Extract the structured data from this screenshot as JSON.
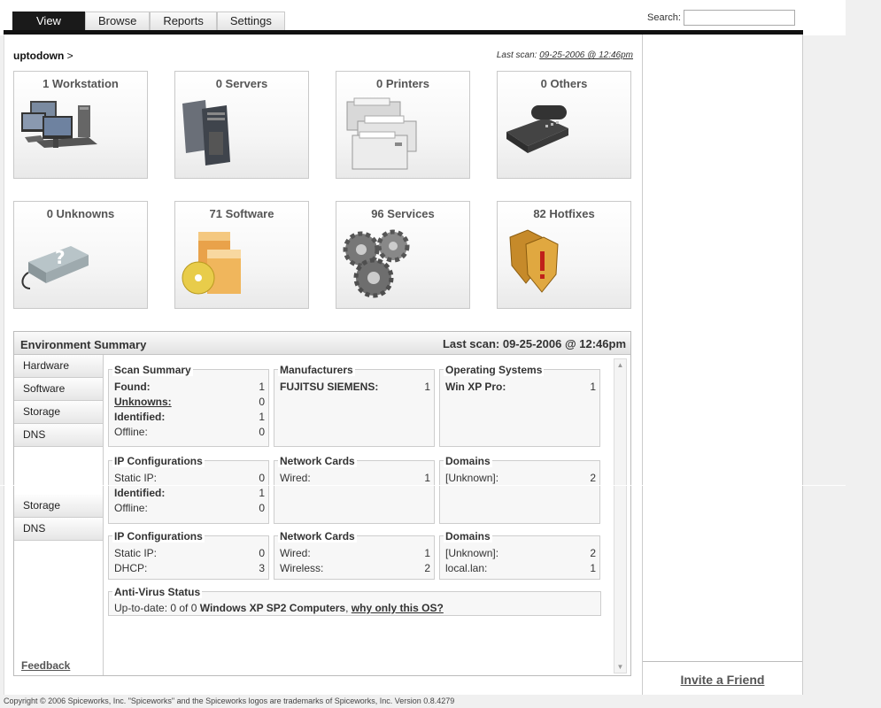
{
  "nav": {
    "tabs": [
      "View",
      "Browse",
      "Reports",
      "Settings"
    ],
    "search_label": "Search:",
    "search_value": ""
  },
  "breadcrumb": {
    "location": "uptodown",
    "separator": ">"
  },
  "last_scan_top": {
    "label": "Last scan:",
    "date": "09-25-2006 @ 12:46pm"
  },
  "cards": [
    {
      "label": "1 Workstation",
      "icon": "workstation-icon"
    },
    {
      "label": "0 Servers",
      "icon": "server-icon"
    },
    {
      "label": "0 Printers",
      "icon": "printer-icon"
    },
    {
      "label": "0 Others",
      "icon": "phone-icon"
    },
    {
      "label": "0 Unknowns",
      "icon": "unknown-device-icon"
    },
    {
      "label": "71 Software",
      "icon": "software-icon"
    },
    {
      "label": "96 Services",
      "icon": "gears-icon"
    },
    {
      "label": "82 Hotfixes",
      "icon": "shield-icon"
    }
  ],
  "env": {
    "title": "Environment Summary",
    "last_scan": "Last scan: 09-25-2006 @ 12:46pm",
    "nav": [
      "Hardware",
      "Software",
      "Storage",
      "DNS",
      "Storage",
      "DNS"
    ],
    "feedback": "Feedback",
    "scan_summary": {
      "title": "Scan Summary",
      "rows": [
        {
          "k": "Found:",
          "v": "1"
        },
        {
          "k": "Unknowns:",
          "v": "0"
        },
        {
          "k": "Identified:",
          "v": "1"
        },
        {
          "k": "Offline:",
          "v": "0"
        }
      ]
    },
    "manufacturers": {
      "title": "Manufacturers",
      "rows": [
        {
          "k": "FUJITSU SIEMENS:",
          "v": "1"
        }
      ]
    },
    "operating_systems": {
      "title": "Operating Systems",
      "rows": [
        {
          "k": "Win XP Pro:",
          "v": "1"
        }
      ]
    },
    "ip_config_1": {
      "title": "IP Configurations",
      "rows": [
        {
          "k": "Static IP:",
          "v": "0"
        },
        {
          "k": "Identified:",
          "v": "1"
        },
        {
          "k": "Offline:",
          "v": "0"
        }
      ]
    },
    "network_cards_1": {
      "title": "Network Cards",
      "rows": [
        {
          "k": "Wired:",
          "v": "1"
        }
      ]
    },
    "domains_1": {
      "title": "Domains",
      "rows": [
        {
          "k": "[Unknown]:",
          "v": "2"
        }
      ]
    },
    "ip_config_2": {
      "title": "IP Configurations",
      "rows": [
        {
          "k": "Static IP:",
          "v": "0"
        },
        {
          "k": "DHCP:",
          "v": "3"
        }
      ]
    },
    "network_cards_2": {
      "title": "Network Cards",
      "rows": [
        {
          "k": "Wired:",
          "v": "1"
        },
        {
          "k": "Wireless:",
          "v": "2"
        }
      ]
    },
    "domains_2": {
      "title": "Domains",
      "rows": [
        {
          "k": "[Unknown]:",
          "v": "2"
        },
        {
          "k": "local.lan:",
          "v": "1"
        }
      ]
    },
    "antivirus": {
      "title": "Anti-Virus Status",
      "prefix": "Up-to-date: 0 of 0",
      "bold": "Windows XP SP2 Computers",
      "sep": ",",
      "link": "why only this OS?"
    }
  },
  "right_panel": {
    "invite": "Invite a Friend"
  },
  "footer": "Copyright © 2006 Spiceworks, Inc. \"Spiceworks\" and the Spiceworks logos are trademarks of Spiceworks, Inc. Version 0.8.4279"
}
